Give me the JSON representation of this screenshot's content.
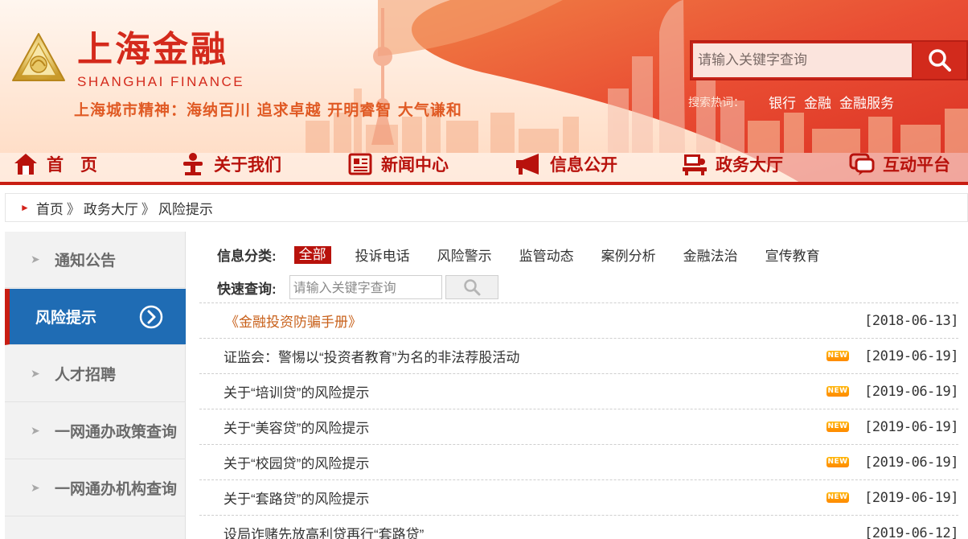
{
  "brand": {
    "name_cn": "上海金融",
    "name_en": "SHANGHAI FINANCE",
    "slogan": "上海城市精神：海纳百川  追求卓越  开明睿智  大气谦和"
  },
  "search": {
    "placeholder": "请输入关键字查询",
    "hot_label": "搜索热词：",
    "hot_words": [
      "银行",
      "金融",
      "金融服务"
    ]
  },
  "nav": {
    "items": [
      {
        "label": "首　页",
        "icon": "home-icon"
      },
      {
        "label": "关于我们",
        "icon": "podium-icon"
      },
      {
        "label": "新闻中心",
        "icon": "newspaper-icon"
      },
      {
        "label": "信息公开",
        "icon": "megaphone-icon"
      },
      {
        "label": "政务大厅",
        "icon": "service-desk-icon"
      },
      {
        "label": "互动平台",
        "icon": "chat-bubble-icon"
      }
    ]
  },
  "breadcrumb": {
    "items": [
      "首页",
      "政务大厅",
      "风险提示"
    ],
    "separator": "》"
  },
  "sidebar": {
    "items": [
      {
        "label": "通知公告",
        "active": false
      },
      {
        "label": "风险提示",
        "active": true
      },
      {
        "label": "人才招聘",
        "active": false
      },
      {
        "label": "一网通办政策查询",
        "active": false
      },
      {
        "label": "一网通办机构查询",
        "active": false
      }
    ]
  },
  "filter": {
    "title": "信息分类:",
    "categories": [
      "全部",
      "投诉电话",
      "风险警示",
      "监管动态",
      "案例分析",
      "金融法治",
      "宣传教育"
    ],
    "active": "全部"
  },
  "quick": {
    "title": "快速查询:",
    "placeholder": "请输入关键字查询"
  },
  "articles": [
    {
      "title": "《金融投资防骗手册》",
      "date": "[2018-06-13]",
      "new": false,
      "highlight": true
    },
    {
      "title": "证监会：警惕以“投资者教育”为名的非法荐股活动",
      "date": "[2019-06-19]",
      "new": true,
      "highlight": false
    },
    {
      "title": "关于“培训贷”的风险提示",
      "date": "[2019-06-19]",
      "new": true,
      "highlight": false
    },
    {
      "title": "关于“美容贷”的风险提示",
      "date": "[2019-06-19]",
      "new": true,
      "highlight": false
    },
    {
      "title": "关于“校园贷”的风险提示",
      "date": "[2019-06-19]",
      "new": true,
      "highlight": false
    },
    {
      "title": "关于“套路贷”的风险提示",
      "date": "[2019-06-19]",
      "new": true,
      "highlight": false
    },
    {
      "title": "设局诈赌先放高利贷再行“套路贷”",
      "date": "[2019-06-12]",
      "new": false,
      "highlight": false
    }
  ],
  "new_badge": "NEW",
  "colors": {
    "brand_red": "#c81d12",
    "sidebar_active": "#1f6cb4",
    "highlight_link": "#c8601a"
  }
}
